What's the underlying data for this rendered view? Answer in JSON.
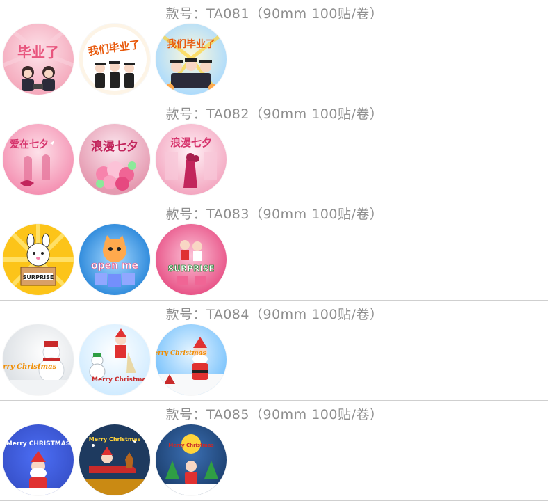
{
  "products": [
    {
      "code_label": "款号：TA081（90mm 100贴/卷）",
      "theme": "graduation",
      "stickers": [
        {
          "name": "graduation-sticker-1",
          "text": "毕业了",
          "colors": [
            "#f6b7c6",
            "#fde3ea"
          ]
        },
        {
          "name": "graduation-sticker-2",
          "text": "我们毕业了",
          "colors": [
            "#fdf4e6",
            "#ffffff"
          ]
        },
        {
          "name": "graduation-sticker-3",
          "text": "我们毕业了",
          "colors": [
            "#fde68a",
            "#b8e0f7"
          ]
        }
      ]
    },
    {
      "code_label": "款号：TA082（90mm 100贴/卷）",
      "theme": "qixi",
      "stickers": [
        {
          "name": "qixi-sticker-1",
          "text": "爱在七夕",
          "colors": [
            "#f7a8c0",
            "#fde1e9"
          ]
        },
        {
          "name": "qixi-sticker-2",
          "text": "浪漫七夕",
          "colors": [
            "#f2b5c8",
            "#f7d9e3"
          ]
        },
        {
          "name": "qixi-sticker-3",
          "text": "浪漫七夕",
          "colors": [
            "#f6bfd0",
            "#fbe6ee"
          ]
        }
      ]
    },
    {
      "code_label": "款号：TA083（90mm 100贴/卷）",
      "theme": "surprise",
      "stickers": [
        {
          "name": "surprise-sticker-1",
          "text": "SURPRISE",
          "colors": [
            "#fcc419",
            "#ffe066"
          ]
        },
        {
          "name": "surprise-sticker-2",
          "text": "open me",
          "colors": [
            "#3b8fe0",
            "#74c0fc"
          ]
        },
        {
          "name": "surprise-sticker-3",
          "text": "SURPRISE",
          "colors": [
            "#f06595",
            "#faa2c1"
          ]
        }
      ]
    },
    {
      "code_label": "款号：TA084（90mm 100贴/卷）",
      "theme": "christmas-light",
      "stickers": [
        {
          "name": "christmas-sticker-1",
          "text": "Merry Christmas",
          "colors": [
            "#e9ecef",
            "#ffffff"
          ]
        },
        {
          "name": "christmas-sticker-2",
          "text": "Merry Christmas",
          "colors": [
            "#e7f5ff",
            "#ffffff"
          ]
        },
        {
          "name": "christmas-sticker-3",
          "text": "Merry Christmas",
          "colors": [
            "#d0ebff",
            "#f1f3f5"
          ]
        }
      ]
    },
    {
      "code_label": "款号：TA085（90mm 100贴/卷）",
      "theme": "christmas-dark",
      "stickers": [
        {
          "name": "christmas-dark-sticker-1",
          "text": "Merry CHRISTMAS",
          "colors": [
            "#364fc7",
            "#4c6ef5"
          ]
        },
        {
          "name": "christmas-dark-sticker-2",
          "text": "Merry Christmas",
          "colors": [
            "#1e3a5f",
            "#2b4c7e"
          ]
        },
        {
          "name": "christmas-dark-sticker-3",
          "text": "Merry Christmas",
          "colors": [
            "#1c3f6e",
            "#2f5d99"
          ]
        }
      ]
    }
  ]
}
